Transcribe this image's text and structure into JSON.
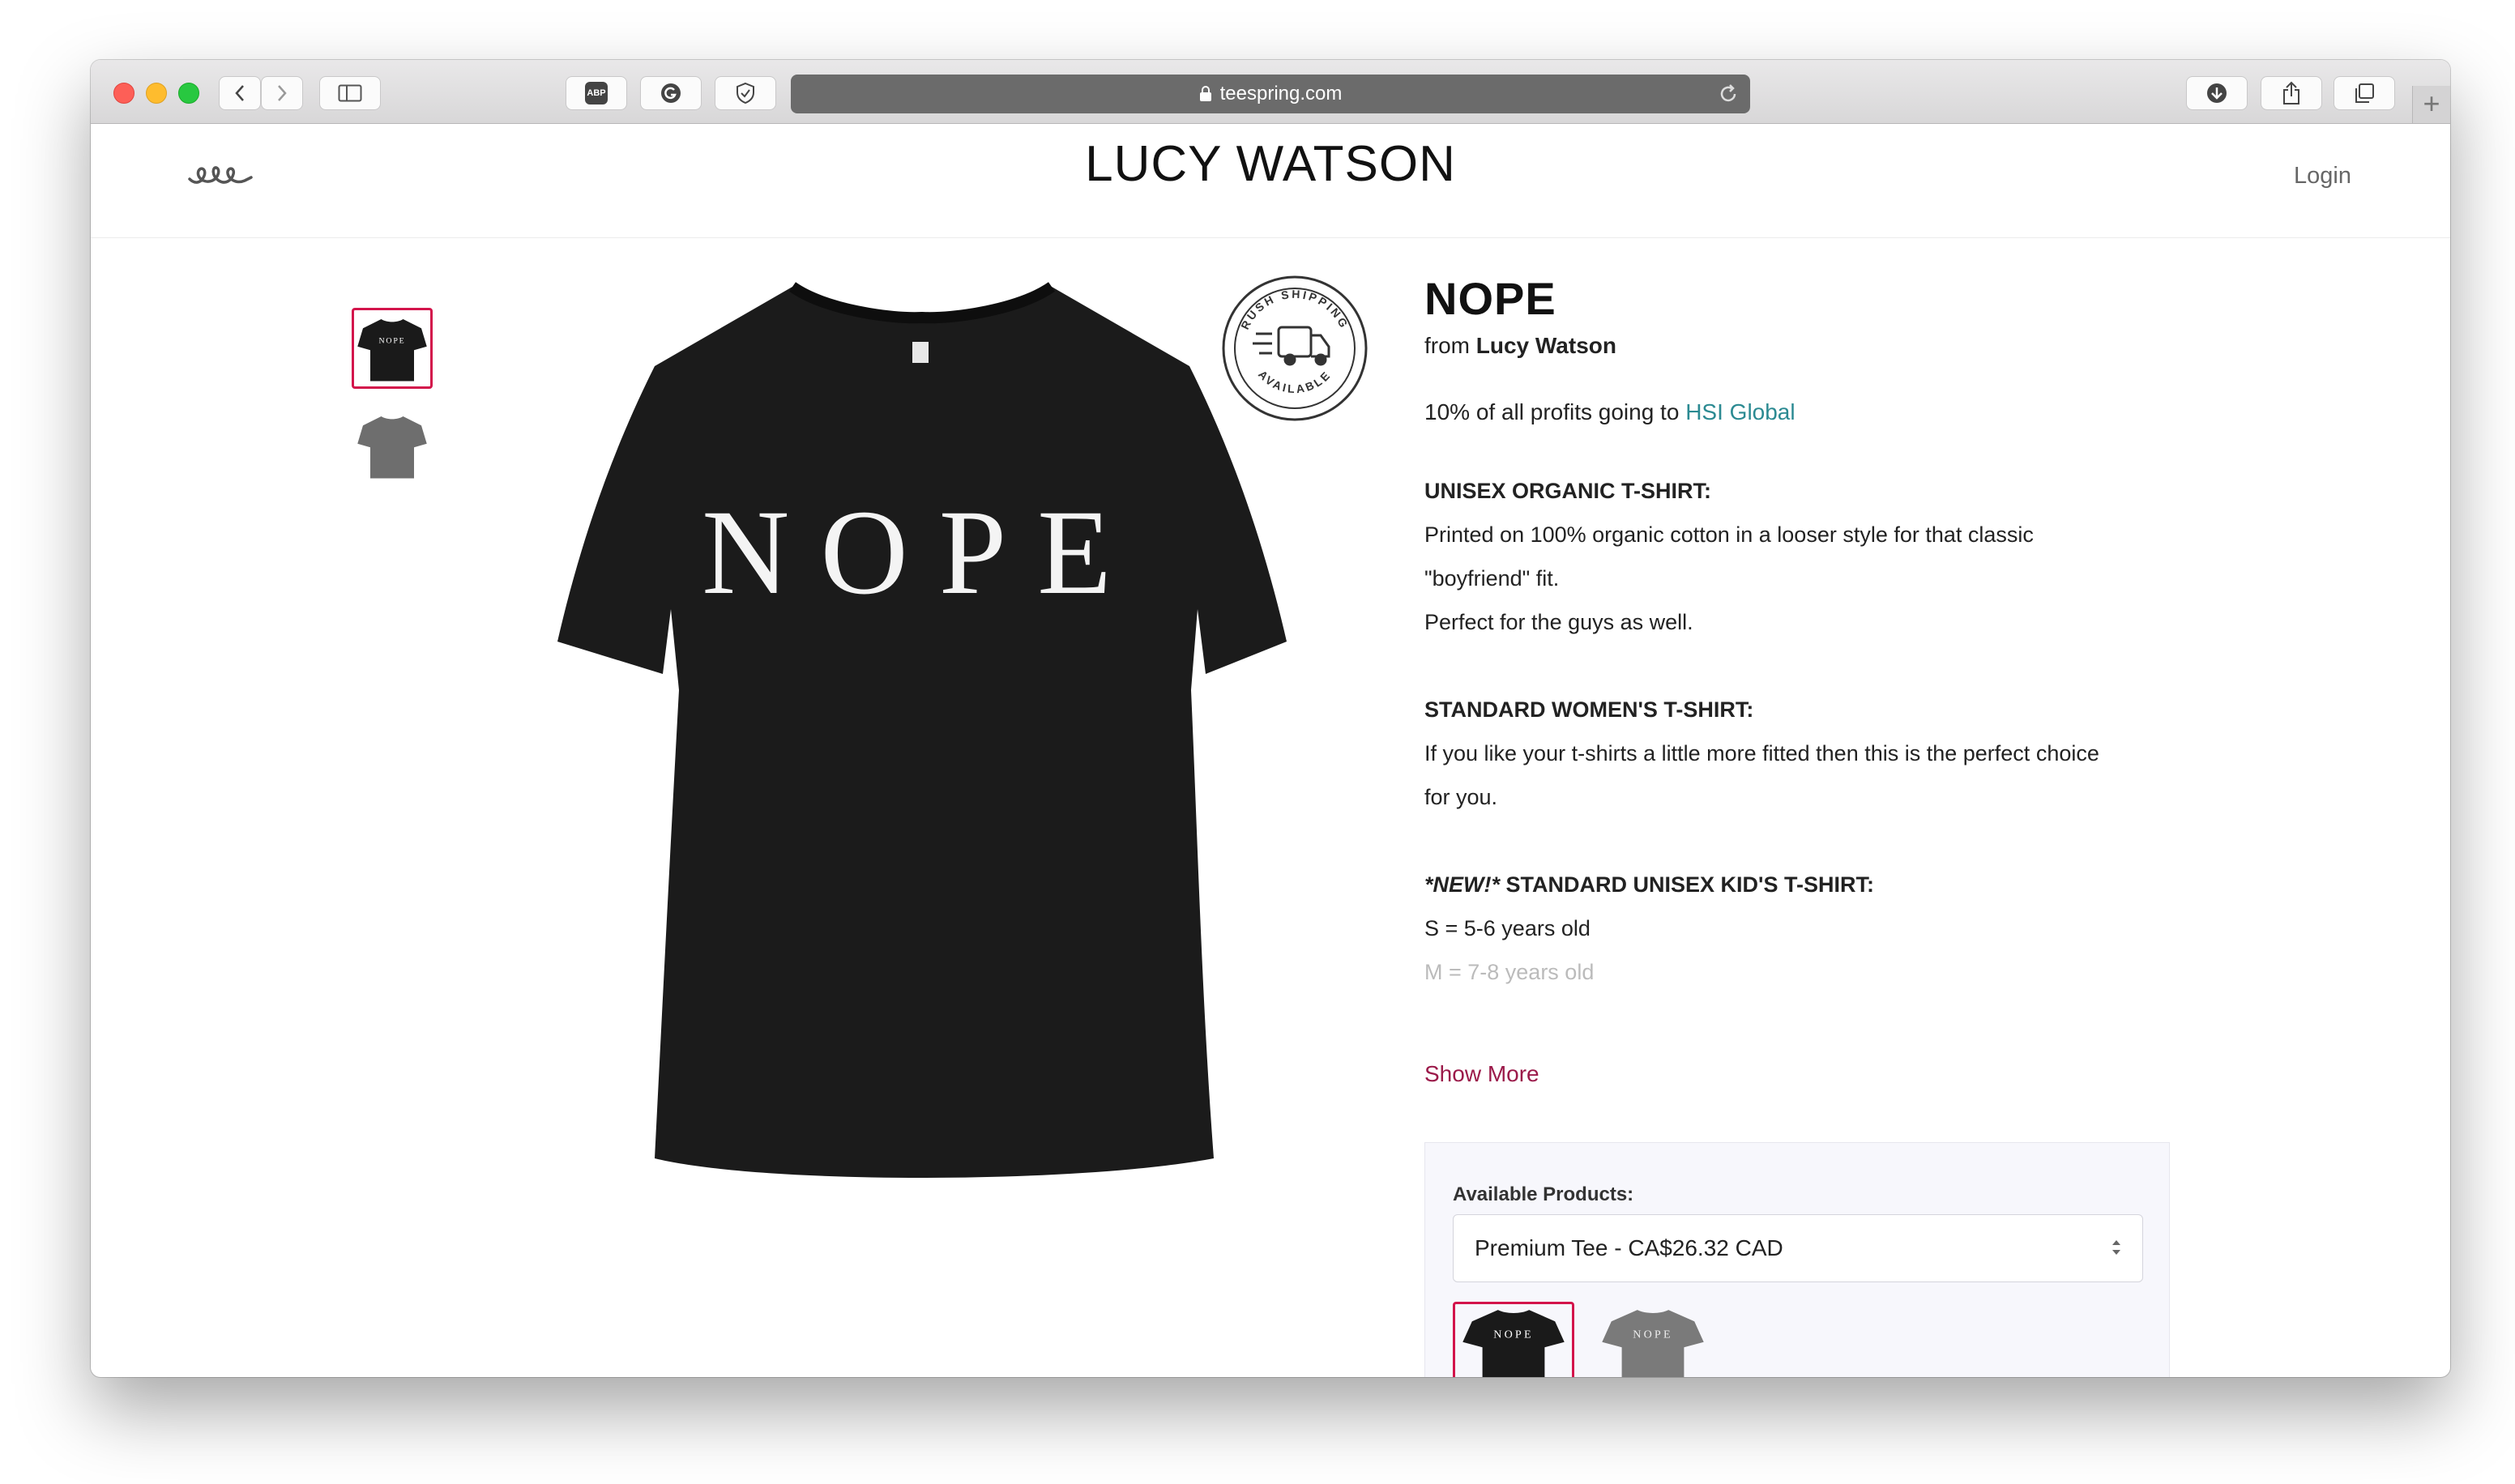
{
  "browser": {
    "url": "teespring.com",
    "toolbar_icons": [
      "back-icon",
      "forward-icon",
      "sidebar-icon",
      "adblock-icon",
      "grammarly-icon",
      "shield-icon",
      "download-icon",
      "share-icon",
      "tabs-icon",
      "new-tab-icon"
    ],
    "adblock_label": "ABP",
    "new_tab_label": "+"
  },
  "header": {
    "store_name": "LUCY WATSON",
    "login_label": "Login"
  },
  "product": {
    "title": "NOPE",
    "from_prefix": "from",
    "creator": "Lucy Watson",
    "shirt_print": "NOPE",
    "charity_prefix": "10% of all profits going to",
    "charity_name": "HSI Global",
    "badge_text_top": "RUSH SHIPPING",
    "badge_text_bottom": "AVAILABLE",
    "description": [
      {
        "type": "heading",
        "text": "UNISEX ORGANIC T-SHIRT:"
      },
      {
        "type": "text",
        "text": "Printed on 100% organic cotton in a looser style for that classic"
      },
      {
        "type": "text",
        "text": "\"boyfriend\" fit."
      },
      {
        "type": "text",
        "text": "Perfect for the guys as well."
      },
      {
        "type": "gap"
      },
      {
        "type": "heading",
        "text": "STANDARD WOMEN'S T-SHIRT:"
      },
      {
        "type": "text",
        "text": "If you like your t-shirts a little more fitted then this is the perfect choice"
      },
      {
        "type": "text",
        "text": "for you."
      },
      {
        "type": "gap"
      },
      {
        "type": "heading_new",
        "prefix": "*NEW!*",
        "text": "STANDARD UNISEX KID'S T-SHIRT:"
      },
      {
        "type": "text",
        "text": "S = 5-6 years old"
      },
      {
        "type": "faded",
        "text": "M = 7-8 years old"
      }
    ],
    "show_more_label": "Show More",
    "available_products_label": "Available Products:",
    "selected_product": "Premium Tee - CA$26.32 CAD",
    "thumbnails": [
      {
        "color": "#1a1a1a",
        "print": "NOPE",
        "active": true
      },
      {
        "color": "#6e6e6e",
        "print": "",
        "active": false
      }
    ],
    "variants": [
      {
        "color": "#1a1a1a",
        "print": "NOPE",
        "active": true
      },
      {
        "color": "#7a7a7a",
        "print": "NOPE",
        "active": false
      }
    ]
  },
  "colors": {
    "accent": "#d3144b",
    "link": "#2b8a92",
    "show_more": "#9b1a4a"
  }
}
